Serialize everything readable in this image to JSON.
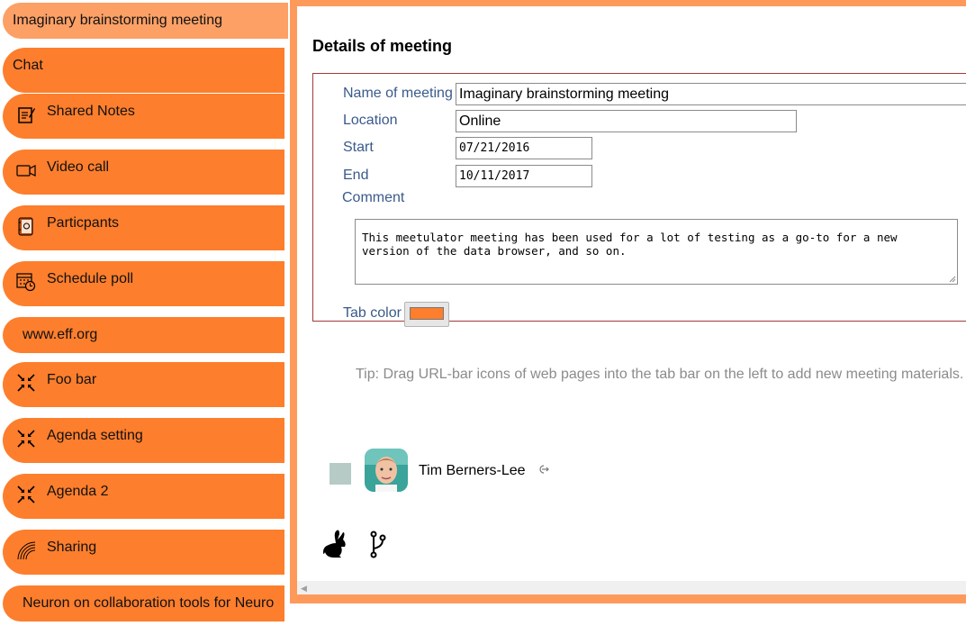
{
  "sidebar": {
    "items": [
      {
        "label": "Imaginary brainstorming meeting",
        "icon": "",
        "selected": true
      },
      {
        "label": "Chat",
        "icon": ""
      },
      {
        "label": "Shared Notes",
        "icon": "notes-icon"
      },
      {
        "label": "Video call",
        "icon": "video-camera-icon"
      },
      {
        "label": "Particpants",
        "icon": "address-book-icon"
      },
      {
        "label": "Schedule poll",
        "icon": "calendar-clock-icon"
      },
      {
        "label": "www.eff.org",
        "icon": ""
      },
      {
        "label": "Foo bar",
        "icon": "collapse-arrows-icon"
      },
      {
        "label": "Agenda setting",
        "icon": "collapse-arrows-icon"
      },
      {
        "label": "Agenda 2",
        "icon": "collapse-arrows-icon"
      },
      {
        "label": "Sharing",
        "icon": "signal-waves-icon"
      },
      {
        "label": "Neuron on collaboration tools for Neuro",
        "icon": ""
      }
    ]
  },
  "details": {
    "title": "Details of meeting",
    "name_label": "Name of meeting",
    "name_value": "Imaginary brainstorming meeting",
    "location_label": "Location",
    "location_value": "Online",
    "start_label": "Start",
    "start_value": "07/21/2016",
    "end_label": "End",
    "end_value": "10/11/2017",
    "comment_label": "Comment",
    "comment_value": "This meetulator meeting has been used for a lot of testing as a go-to for a new version of the data browser, and so on.",
    "tab_color_label": "Tab color",
    "tab_color_value": "#fd7e2d"
  },
  "tip": "Tip: Drag URL-bar icons of web pages into the tab bar on the left to add new meeting materials.",
  "participant": {
    "name": "Tim Berners-Lee",
    "link_icon": "link-out-icon",
    "avatar_icon": "avatar"
  },
  "footer_icons": [
    "rabbit-icon",
    "git-fork-icon"
  ],
  "colors": {
    "tab": "#fd7e2d",
    "selected_tab": "#fca066",
    "frame": "#fd9a5b",
    "label": "#3a5a8c",
    "form_border": "#a23b3b"
  }
}
